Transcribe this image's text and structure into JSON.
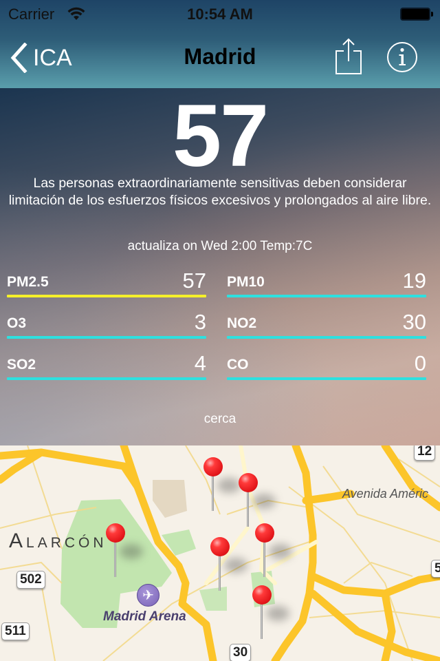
{
  "status_bar": {
    "carrier": "Carrier",
    "time": "10:54 AM",
    "wifi_icon": "wifi-icon",
    "battery_icon": "battery-icon"
  },
  "nav": {
    "back_label": "ICA",
    "title": "Madrid",
    "back_icon": "chevron-left-icon",
    "share_icon": "share-icon",
    "info_icon": "info-icon"
  },
  "aqi": {
    "value": "57",
    "advice": "Las personas extraordinariamente sensitivas deben considerar limitación de los esfuerzos físicos excesivos y prolongados al aire libre.",
    "update": "actualiza on Wed 2:00 Temp:7C"
  },
  "pollutants": [
    {
      "name": "PM2.5",
      "value": "57",
      "color": "#f5f02a"
    },
    {
      "name": "PM10",
      "value": "19",
      "color": "#2ee0df"
    },
    {
      "name": "O3",
      "value": "3",
      "color": "#2ee0df"
    },
    {
      "name": "NO2",
      "value": "30",
      "color": "#2ee0df"
    },
    {
      "name": "SO2",
      "value": "4",
      "color": "#2ee0df"
    },
    {
      "name": "CO",
      "value": "0",
      "color": "#2ee0df"
    }
  ],
  "nearby_label": "cerca",
  "map": {
    "labels": {
      "district": "Alarcón",
      "poi": "Madrid Arena",
      "street": "Avenida Améric"
    },
    "road_shields": [
      "12",
      "502",
      "511",
      "30",
      "5"
    ],
    "poi_icon": "airplane-icon",
    "pin_count": 6
  }
}
